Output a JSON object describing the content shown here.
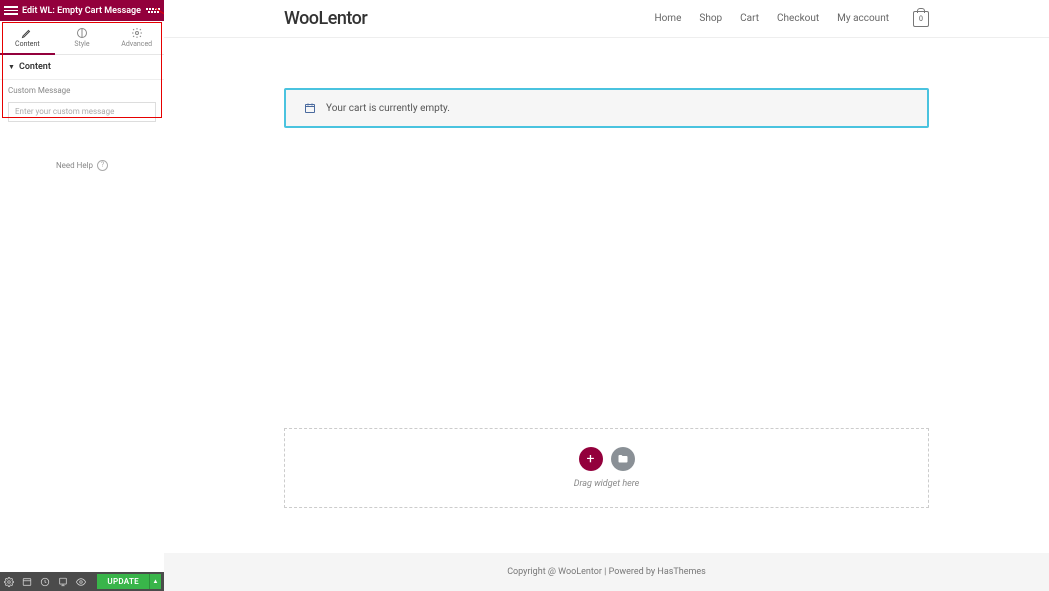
{
  "sidebar": {
    "header_title": "Edit WL: Empty Cart Message",
    "tabs": {
      "content": "Content",
      "style": "Style",
      "advanced": "Advanced"
    },
    "section_title": "Content",
    "custom_message_label": "Custom Message",
    "custom_message_placeholder": "Enter your custom message",
    "help_text": "Need Help",
    "update_label": "UPDATE"
  },
  "preview": {
    "logo": "WooLentor",
    "nav": {
      "home": "Home",
      "shop": "Shop",
      "cart": "Cart",
      "checkout": "Checkout",
      "account": "My account",
      "bag_count": "0"
    },
    "notice_text": "Your cart is currently empty.",
    "drop_hint": "Drag widget here",
    "footer_text": "Copyright @ WooLentor | Powered by HasThemes"
  }
}
